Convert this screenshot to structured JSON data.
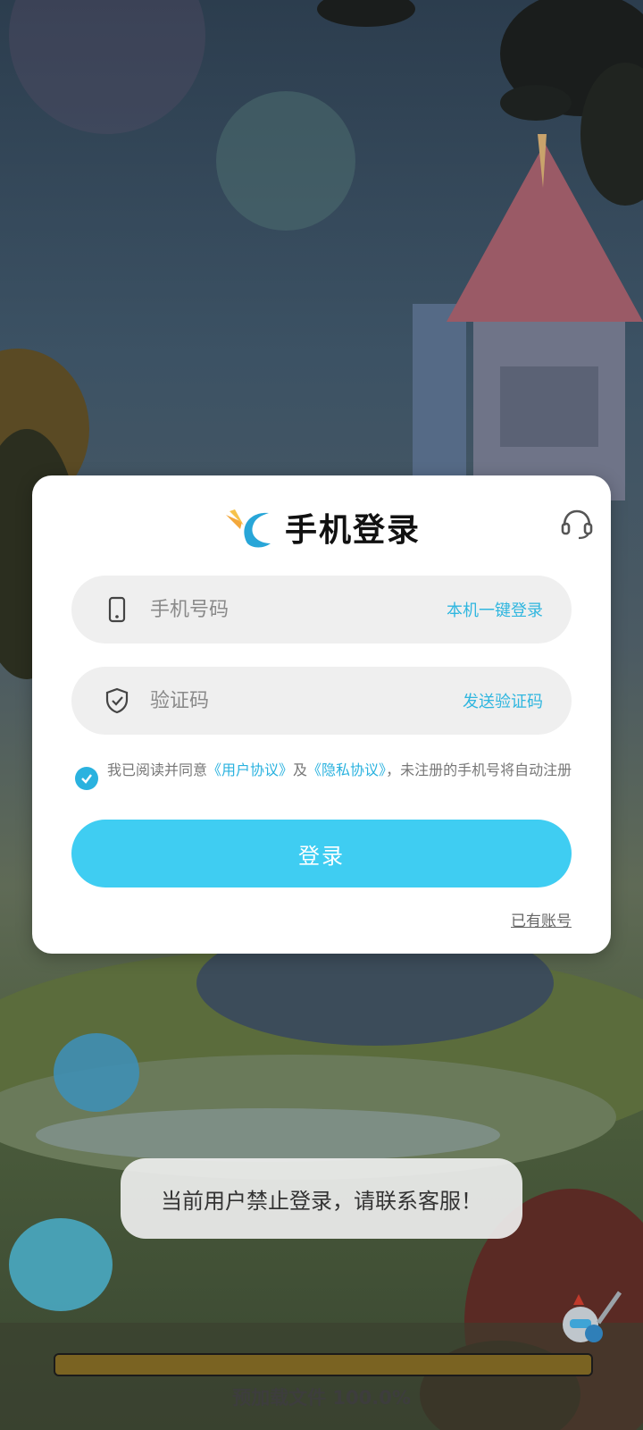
{
  "card": {
    "title": "手机登录",
    "support_icon": "headset-icon",
    "phone_field": {
      "icon": "phone-icon",
      "placeholder": "手机号码",
      "value": "",
      "action_label": "本机一键登录"
    },
    "code_field": {
      "icon": "shield-check-icon",
      "placeholder": "验证码",
      "value": "",
      "action_label": "发送验证码"
    },
    "agreement": {
      "checked": true,
      "prefix": "我已阅读并同意",
      "user_agreement": "《用户协议》",
      "and": "及",
      "privacy_agreement": "《隐私协议》",
      "suffix": "，未注册的手机号将自动注册"
    },
    "login_button": "登录",
    "have_account": "已有账号"
  },
  "toast": "当前用户禁止登录，请联系客服！",
  "loading": {
    "label": "预加载文件 100.0%",
    "progress": 1.0
  },
  "colors": {
    "accent": "#3fcdf2",
    "link": "#2ab2df",
    "field_bg": "#efefef",
    "progress_fill": "#7a6322"
  }
}
